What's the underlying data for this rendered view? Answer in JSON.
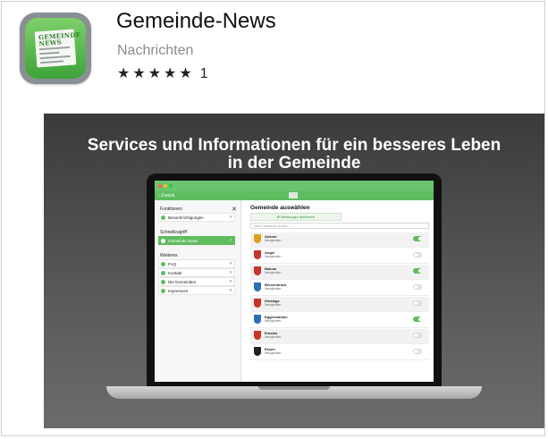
{
  "app": {
    "title": "Gemeinde-News",
    "category": "Nachrichten",
    "stars": "★★★★★",
    "rating_count": "1",
    "icon_masthead_1": "GEMEINDE",
    "icon_masthead_2": "NEWS"
  },
  "banner": {
    "title_line1": "Services und Informationen für ein besseres Leben",
    "title_line2": "in der Gemeinde"
  },
  "device": {
    "back_label": "‹ Zurück",
    "sidebar": {
      "section1": "Funktionen",
      "section2": "Schnellzugriff",
      "section3": "Weiteres",
      "items": [
        {
          "label": "Benachrichtigungen"
        },
        {
          "label": "Gemeinde News"
        },
        {
          "label": "FAQ"
        },
        {
          "label": "Kontakt"
        },
        {
          "label": "Die Gemeinden"
        },
        {
          "label": "Impressum"
        }
      ]
    },
    "main": {
      "title": "Gemeinde auswählen",
      "button": "⊕ Meldungen aktivieren",
      "search_placeholder": "Nach Gemeinde suchen...",
      "rows": [
        {
          "name": "Ankum",
          "sub": "Neuigkeiten",
          "on": true,
          "crest": "#d9a21b"
        },
        {
          "name": "Angel",
          "sub": "Neuigkeiten",
          "on": false,
          "crest": "#c8342c"
        },
        {
          "name": "Bakum",
          "sub": "Neuigkeiten",
          "on": true,
          "crest": "#c8342c"
        },
        {
          "name": "Bersenbrück",
          "sub": "Neuigkeiten",
          "on": false,
          "crest": "#2e6db7"
        },
        {
          "name": "Dinklage",
          "sub": "Neuigkeiten",
          "on": false,
          "crest": "#c8342c"
        },
        {
          "name": "Eggermühlen",
          "sub": "Neuigkeiten",
          "on": true,
          "crest": "#2e6db7"
        },
        {
          "name": "Emstek",
          "sub": "Neuigkeiten",
          "on": false,
          "crest": "#c8342c"
        },
        {
          "name": "Essen",
          "sub": "Neuigkeiten",
          "on": false,
          "crest": "#222222"
        }
      ]
    }
  }
}
